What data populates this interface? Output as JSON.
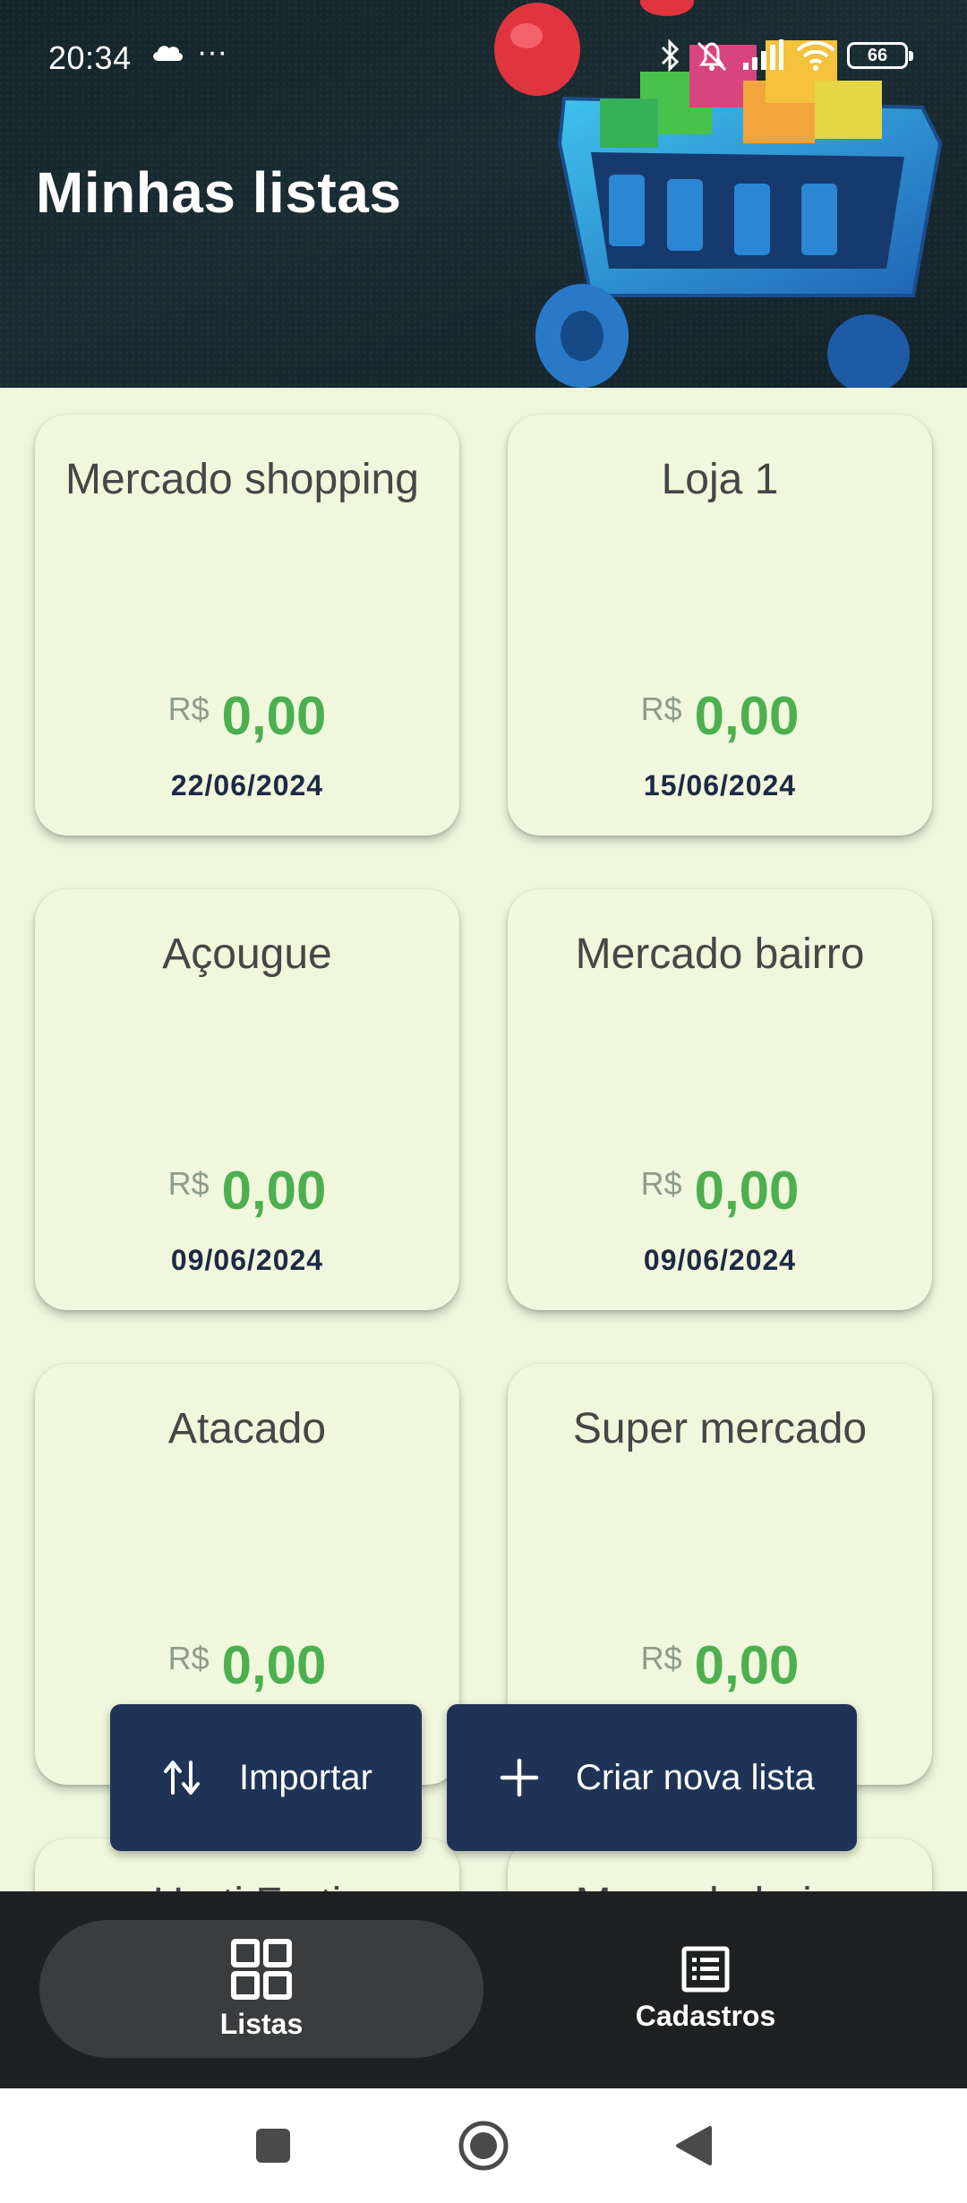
{
  "status_bar": {
    "time": "20:34",
    "more_indicator": "···",
    "battery_level": "66"
  },
  "header": {
    "title": "Minhas listas"
  },
  "lists": [
    {
      "name": "Mercado shopping",
      "currency": "R$",
      "total": "0,00",
      "date": "22/06/2024"
    },
    {
      "name": "Loja 1",
      "currency": "R$",
      "total": "0,00",
      "date": "15/06/2024"
    },
    {
      "name": "Açougue",
      "currency": "R$",
      "total": "0,00",
      "date": "09/06/2024"
    },
    {
      "name": "Mercado bairro",
      "currency": "R$",
      "total": "0,00",
      "date": "09/06/2024"
    },
    {
      "name": "Atacado",
      "currency": "R$",
      "total": "0,00",
      "date": ""
    },
    {
      "name": "Super mercado",
      "currency": "R$",
      "total": "0,00",
      "date": ""
    },
    {
      "name": "Horti Fruti",
      "currency": "",
      "total": "",
      "date": ""
    },
    {
      "name": "Mercado bairro",
      "currency": "",
      "total": "",
      "date": ""
    }
  ],
  "actions": {
    "import_label": "Importar",
    "create_label": "Criar nova lista"
  },
  "bottom_nav": {
    "lists_label": "Listas",
    "registry_label": "Cadastros"
  },
  "colors": {
    "background": "#eef6dc",
    "card": "#f0f7dc",
    "price_green": "#4caf50",
    "button_navy": "#1f3357",
    "nav_dark": "#1e2021"
  }
}
